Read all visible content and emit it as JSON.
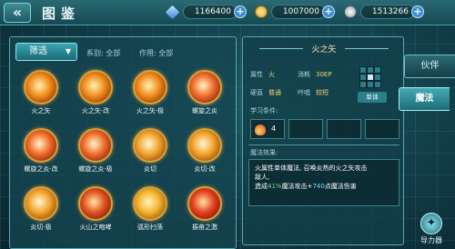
{
  "header": {
    "back_label": "«",
    "title": "图鉴",
    "currencies": [
      {
        "name": "crystal",
        "value": "1166400",
        "color": "#5aa8ff",
        "icon": "crystal-icon"
      },
      {
        "name": "gold",
        "value": "1007000",
        "color": "#f2c23a",
        "icon": "gold-coin-icon"
      },
      {
        "name": "silver",
        "value": "1513266",
        "color": "#c9d1d6",
        "icon": "silver-coin-icon"
      }
    ],
    "plus_label": "+"
  },
  "left_panel": {
    "filter_label": "筛选",
    "series_label": "系别: 全部",
    "effect_filter_label": "作用: 全部",
    "skills": [
      {
        "name": "火之矢",
        "icon": "fire-arrow-icon",
        "colors": [
          "#fff2b0",
          "#f08a1c",
          "#6b1a00"
        ]
      },
      {
        "name": "火之矢·改",
        "icon": "fire-arrow-icon",
        "colors": [
          "#fff2b0",
          "#f08a1c",
          "#6b1a00"
        ]
      },
      {
        "name": "火之矢·极",
        "icon": "fire-arrow-icon",
        "colors": [
          "#fff2b0",
          "#f08a1c",
          "#6b1a00"
        ]
      },
      {
        "name": "螺旋之炎",
        "icon": "spiral-flame-icon",
        "colors": [
          "#fff5c8",
          "#f06a2a",
          "#5a0e08"
        ]
      },
      {
        "name": "螺旋之炎·改",
        "icon": "spiral-flame-icon",
        "colors": [
          "#fff5c8",
          "#f06a2a",
          "#5a0e08"
        ]
      },
      {
        "name": "螺旋之炎·极",
        "icon": "spiral-flame-icon",
        "colors": [
          "#fff5c8",
          "#f06a2a",
          "#5a0e08"
        ]
      },
      {
        "name": "炎切",
        "icon": "flame-slash-icon",
        "colors": [
          "#fff8d8",
          "#f2a22a",
          "#6b2a00"
        ]
      },
      {
        "name": "炎切·改",
        "icon": "flame-slash-icon",
        "colors": [
          "#fff8d8",
          "#f2a22a",
          "#6b2a00"
        ]
      },
      {
        "name": "炎切·极",
        "icon": "flame-slash-icon",
        "colors": [
          "#fff8d8",
          "#f2a22a",
          "#6b2a00"
        ]
      },
      {
        "name": "火山之咆哮",
        "icon": "volcano-roar-icon",
        "colors": [
          "#ffe6a0",
          "#e0521e",
          "#4a0a06"
        ]
      },
      {
        "name": "弧形扫荡",
        "icon": "arc-sweep-icon",
        "colors": [
          "#fff6c0",
          "#f5b22e",
          "#6b3a00"
        ]
      },
      {
        "name": "振奋之激",
        "icon": "inspire-icon",
        "colors": [
          "#ffe0a0",
          "#e4401e",
          "#5a0a06"
        ]
      }
    ]
  },
  "detail": {
    "skill_title": "火之矢",
    "attr_label": "属性",
    "attr_value": "火",
    "cost_label": "消耗",
    "cost_value": "30EP",
    "hardness_label": "硬直",
    "hardness_value": "普通",
    "cast_label": "吟唱",
    "cast_value": "较短",
    "target_label": "单体",
    "requirements_label": "学习条件:",
    "requirement_value": "4",
    "effect_title": "魔法效果:",
    "effect_line1": "火属性单体魔法, 召唤炎热的火之矢攻击",
    "effect_line2": "敌人,",
    "effect_line3_a": "造成",
    "effect_pct": "41%",
    "effect_line3_b": "魔法攻击+",
    "effect_flat": "740",
    "effect_line3_c": "点魔法伤害"
  },
  "side_tabs": {
    "partner": "伙伴",
    "magic": "魔法"
  },
  "guide": {
    "label": "导力器"
  }
}
